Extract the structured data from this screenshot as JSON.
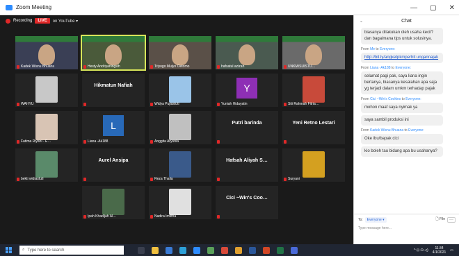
{
  "window": {
    "title": "Zoom Meeting",
    "min": "—",
    "max": "▢",
    "close": "✕"
  },
  "meeting": {
    "recording": "Recording",
    "live": "LIVE",
    "youtube": "on YouTube ▾"
  },
  "participants": [
    {
      "name": "Kadek Wisnu Bhuana",
      "kind": "video",
      "color": "#3a3f55"
    },
    {
      "name": "Hesty Andriyaningsih",
      "kind": "video",
      "color": "#4a5a3a",
      "speaking": true
    },
    {
      "name": "Triyogo Mulyo Oetomo",
      "kind": "video",
      "color": "#5a5048"
    },
    {
      "name": "hafsatul azizah",
      "kind": "video",
      "color": "#4a5a50"
    },
    {
      "name": "UNKM/SUISTU…",
      "kind": "video",
      "color": "#6a6a6a"
    },
    {
      "name": "WAHYU",
      "kind": "photo",
      "color": "#c8c8c8"
    },
    {
      "name": "",
      "big": "Hikmatun Nafiah",
      "kind": "text"
    },
    {
      "name": "Widya Pujiastuti",
      "kind": "photo",
      "color": "#9ac4e8"
    },
    {
      "name": "Yuniah Hidayatin",
      "kind": "letter",
      "letter": "Y",
      "color": "#8e2fb5"
    },
    {
      "name": "Siti Rahmah Fitria…",
      "kind": "photo",
      "color": "#c84a3a"
    },
    {
      "name": "Fatima Riyani - E…",
      "kind": "photo",
      "color": "#d8c4b4"
    },
    {
      "name": "Liana -Ak188",
      "kind": "letter",
      "letter": "L",
      "color": "#2869b8"
    },
    {
      "name": "Anggita Aryunia",
      "kind": "photo",
      "color": "#c0c0c0"
    },
    {
      "name": "",
      "big": "Putri barinda",
      "kind": "text"
    },
    {
      "name": "",
      "big": "Yeni Retno Lestari",
      "kind": "text"
    },
    {
      "name": "bekti widiastuti",
      "kind": "photo",
      "color": "#5a8a6a"
    },
    {
      "name": "",
      "big": "Aurel Ansipa",
      "kind": "text"
    },
    {
      "name": "Reza Thalia",
      "kind": "photo",
      "color": "#3a5a8a"
    },
    {
      "name": "",
      "big": "Hafsah Aliyah S…",
      "kind": "text"
    },
    {
      "name": "Suryani",
      "kind": "photo",
      "color": "#d4a020"
    },
    {
      "name": "",
      "kind": "empty"
    },
    {
      "name": "Ipah Khadijah Al…",
      "kind": "photo",
      "color": "#4a6a4a"
    },
    {
      "name": "Nadira Imtitha",
      "kind": "photo",
      "color": "#e0e0e0"
    },
    {
      "name": "",
      "big": "Cici ~Win's Coo…",
      "kind": "text"
    },
    {
      "name": "",
      "kind": "empty"
    }
  ],
  "chat": {
    "title": "Chat",
    "collapse": "⌄",
    "messages": [
      {
        "from": "",
        "to": "",
        "text": "biasanya dilakukan oleh usaha kecil?dan bagaimana tips untuk solusinya."
      },
      {
        "from": "Me",
        "to": "Everyone",
        "text": "http://bit.ly/angketpkmperhit ungannajak",
        "link": true
      },
      {
        "from": "Liana -Ak188",
        "to": "Everyone",
        "text": "selamat pagi pak, saya liana ingin bertanya, biasanya kesalahan apa saja yg terjadi dalam umkm terhadap pajak"
      },
      {
        "from": "Cici ~Win's Cookies",
        "to": "Everyone",
        "text": "mohon maaf saya nyimak ya"
      },
      {
        "from": "",
        "to": "",
        "text": "saya sambil produksi ini"
      },
      {
        "from": "Kadek Wisnu Bhuana",
        "to": "Everyone",
        "text": "Oke ibu/bapak cici"
      },
      {
        "from": "",
        "to": "",
        "text": "kio boleh tau bidang apa bu usahanya?"
      }
    ],
    "from_prefix": "From",
    "to_word": "to",
    "to_label": "To:",
    "to_value": "Everyone ▾",
    "file_label": "File",
    "more": "···",
    "placeholder": "Type message here..."
  },
  "taskbar": {
    "search_placeholder": "Type here to search",
    "time": "11:34",
    "date": "4/1/2021"
  }
}
